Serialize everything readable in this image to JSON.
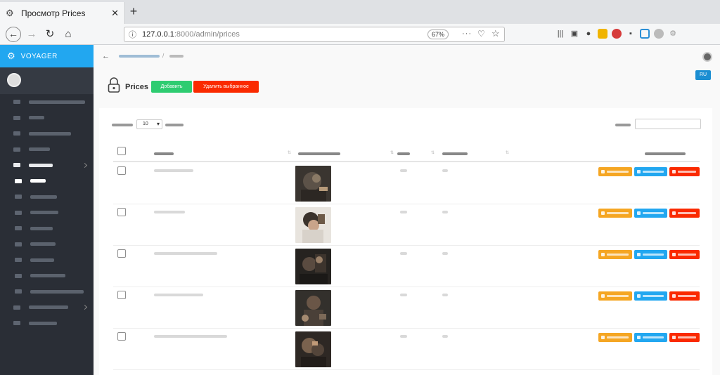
{
  "browser": {
    "tab_title": "Просмотр Prices",
    "tab_close": "✕",
    "new_tab": "+",
    "url_host": "127.0.0.1",
    "url_path": ":8000/admin/prices",
    "zoom": "67%",
    "url_more": "···"
  },
  "sidebar": {
    "brand": "VOYAGER",
    "items": [
      {
        "key": "dashboard",
        "ph": 80
      },
      {
        "key": "roles",
        "ph": 22
      },
      {
        "key": "users",
        "ph": 60
      },
      {
        "key": "media",
        "ph": 30
      },
      {
        "key": "barbershop",
        "ph": 34,
        "active": true,
        "caret": true
      },
      {
        "key": "prices",
        "ph": 22,
        "current": true
      },
      {
        "key": "barbers",
        "ph": 38
      },
      {
        "key": "categories",
        "ph": 40
      },
      {
        "key": "services",
        "ph": 32
      },
      {
        "key": "gallery",
        "ph": 36
      },
      {
        "key": "contacts",
        "ph": 34
      },
      {
        "key": "schedule",
        "ph": 50
      },
      {
        "key": "telegram-settings",
        "ph": 76
      },
      {
        "key": "tools",
        "ph": 56,
        "caret": true
      },
      {
        "key": "settings",
        "ph": 40
      }
    ]
  },
  "header": {
    "back": "←",
    "page_title": "Prices",
    "lang": "RU",
    "btn_add": "Добавить",
    "btn_delete_selected": "Удалить выбранное"
  },
  "table": {
    "show_value": "10",
    "columns": [
      {
        "key": "name",
        "ph": 28
      },
      {
        "key": "image",
        "ph": 60
      },
      {
        "key": "price",
        "ph": 18
      },
      {
        "key": "show",
        "ph": 36
      },
      {
        "key": "actions",
        "ph": 58
      }
    ],
    "rows": [
      {
        "name_ph": 56,
        "price_ph": 10,
        "show_ph": 8,
        "img": 0
      },
      {
        "name_ph": 44,
        "price_ph": 10,
        "show_ph": 8,
        "img": 1
      },
      {
        "name_ph": 90,
        "price_ph": 10,
        "show_ph": 8,
        "img": 2
      },
      {
        "name_ph": 70,
        "price_ph": 10,
        "show_ph": 8,
        "img": 3
      },
      {
        "name_ph": 104,
        "price_ph": 10,
        "show_ph": 8,
        "img": 4
      }
    ]
  },
  "colors": {
    "brand": "#22a7f0",
    "sidebar": "#2a2e36",
    "add": "#2ecc71",
    "danger": "#fa2a00",
    "view": "#f5a623",
    "edit": "#22a7f0"
  },
  "icons": {
    "favicon": "gear-icon",
    "back": "arrow-left-icon",
    "reload": "reload-icon",
    "home": "home-icon",
    "lock": "lock-icon"
  }
}
